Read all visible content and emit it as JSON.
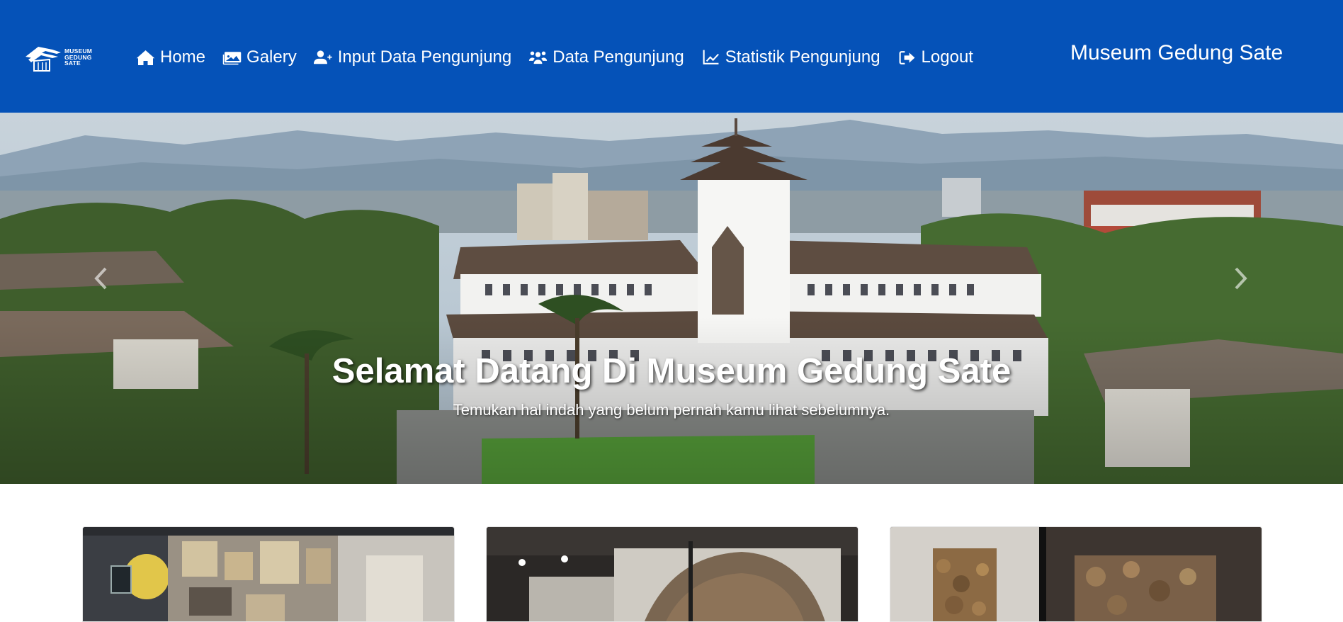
{
  "navbar": {
    "background": "#0552b8",
    "brand": {
      "logo_lines": [
        "MUSEUM",
        "GEDUNG",
        "SATE"
      ],
      "icon": "museum-logo-icon"
    },
    "items": [
      {
        "label": "Home",
        "icon": "home-icon"
      },
      {
        "label": "Galery",
        "icon": "image-icon"
      },
      {
        "label": "Input Data Pengunjung",
        "icon": "user-plus-icon"
      },
      {
        "label": "Data Pengunjung",
        "icon": "users-icon"
      },
      {
        "label": "Statistik Pengunjung",
        "icon": "chart-line-icon"
      },
      {
        "label": "Logout",
        "icon": "sign-out-icon"
      }
    ],
    "site_title": "Museum Gedung Sate"
  },
  "carousel": {
    "title": "Selamat Datang Di Museum Gedung Sate",
    "subtitle": "Temukan hal indah yang belum pernah kamu lihat sebelumnya.",
    "prev_icon": "chevron-left-icon",
    "next_icon": "chevron-right-icon"
  },
  "cards": [
    {
      "name": "gallery-card-1"
    },
    {
      "name": "gallery-card-2"
    },
    {
      "name": "gallery-card-3"
    }
  ]
}
